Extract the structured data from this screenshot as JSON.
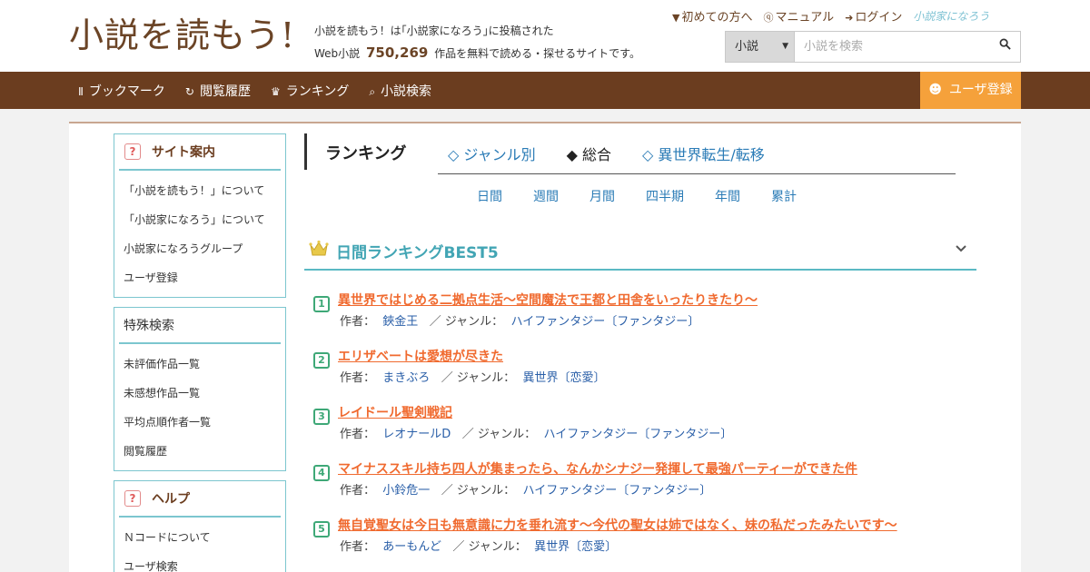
{
  "header": {
    "logo": "小説を読もう!",
    "tagline_line1": "小説を読もう！は｢小説家になろう｣に投稿された",
    "tagline_pre": "Web小説",
    "tagline_count": "750,269",
    "tagline_post": "作品を無料で読める・探せるサイトです。",
    "links": [
      {
        "label": "初めての方へ",
        "icon": "book-icon"
      },
      {
        "label": "マニュアル",
        "icon": "help-circle-icon"
      },
      {
        "label": "ログイン",
        "icon": "login-icon"
      }
    ],
    "brand_mini": "小説家になろう",
    "search": {
      "select_value": "小説",
      "placeholder": "小説を検索",
      "button_icon": "search-icon"
    }
  },
  "nav": {
    "items": [
      {
        "label": "ブックマーク",
        "icon": "bookmark-icon"
      },
      {
        "label": "閲覧履歴",
        "icon": "history-icon"
      },
      {
        "label": "ランキング",
        "icon": "crown-icon"
      },
      {
        "label": "小説検索",
        "icon": "search-icon"
      }
    ],
    "register": {
      "label": "ユーザ登録",
      "icon": "user-icon"
    }
  },
  "sidebar": {
    "site_guide": {
      "title": "サイト案内",
      "items": [
        "「小説を読もう！」について",
        "「小説家になろう」について",
        "小説家になろうグループ",
        "ユーザ登録"
      ]
    },
    "special_search": {
      "title": "特殊検索",
      "items": [
        "未評価作品一覧",
        "未感想作品一覧",
        "平均点順作者一覧",
        "閲覧履歴"
      ]
    },
    "help": {
      "title": "ヘルプ",
      "items": [
        "Ｎコードについて",
        "ユーザ検索"
      ]
    }
  },
  "main": {
    "title": "ランキング",
    "tabs": [
      {
        "label": "◇ ジャンル別",
        "active": false
      },
      {
        "label": "◆ 総合",
        "active": true
      },
      {
        "label": "◇ 異世界転生/転移",
        "active": false
      }
    ],
    "periods": [
      "日間",
      "週間",
      "月間",
      "四半期",
      "年間",
      "累計"
    ],
    "best_title": "日間ランキングBEST5",
    "author_label": "作者：",
    "genre_label": "／ ジャンル：",
    "rankings": [
      {
        "num": "1",
        "title": "異世界ではじめる二拠点生活～空間魔法で王都と田舎をいったりきたり～",
        "author": "鋏金王",
        "genre": "ハイファンタジー〔ファンタジー〕"
      },
      {
        "num": "2",
        "title": "エリザベートは愛想が尽きた",
        "author": "まきぶろ",
        "genre": "異世界〔恋愛〕"
      },
      {
        "num": "3",
        "title": "レイドール聖剣戦記",
        "author": "レオナールD",
        "genre": "ハイファンタジー〔ファンタジー〕"
      },
      {
        "num": "4",
        "title": "マイナススキル持ち四人が集まったら、なんかシナジー発揮して最強パーティーができた件",
        "author": "小鈴危一",
        "genre": "ハイファンタジー〔ファンタジー〕"
      },
      {
        "num": "5",
        "title": "無自覚聖女は今日も無意識に力を垂れ流す〜今代の聖女は姉ではなく、妹の私だったみたいです〜",
        "author": "あーもんど",
        "genre": "異世界〔恋愛〕"
      }
    ]
  },
  "colors": {
    "brown": "#6b3d1f",
    "orange": "#f5a13b",
    "teal": "#5bb9c4",
    "link_blue": "#2a7bb6",
    "title_orange": "#f06a2f"
  }
}
